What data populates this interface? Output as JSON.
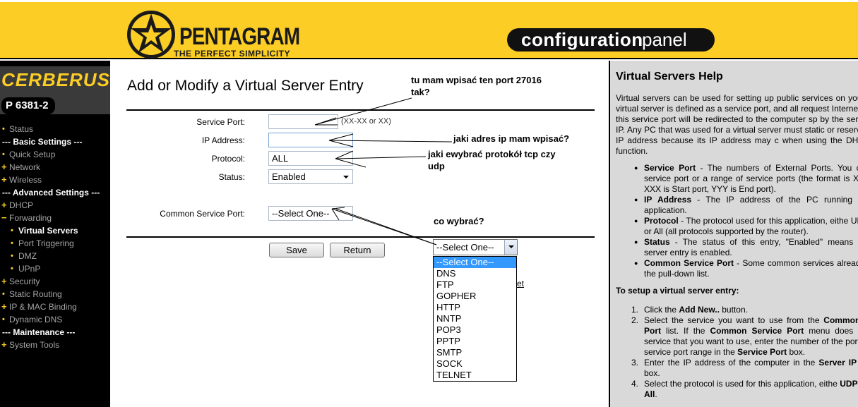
{
  "header": {
    "brand": "PENTAGRAM",
    "tagline": "THE PERFECT SIMPLICITY",
    "config_bold": "configuration",
    "config_light": "panel"
  },
  "sidebar": {
    "device_name": "CERBERUS",
    "model": "P 6381-2",
    "items": [
      {
        "label": "Status",
        "kind": "item"
      },
      {
        "label": "--- Basic Settings ---",
        "kind": "section"
      },
      {
        "label": "Quick Setup",
        "kind": "item"
      },
      {
        "label": "Network",
        "kind": "plus"
      },
      {
        "label": "Wireless",
        "kind": "plus"
      },
      {
        "label": "--- Advanced Settings ---",
        "kind": "section"
      },
      {
        "label": "DHCP",
        "kind": "plus"
      },
      {
        "label": "Forwarding",
        "kind": "minus"
      },
      {
        "label": "Virtual Servers",
        "kind": "sub-active"
      },
      {
        "label": "Port Triggering",
        "kind": "sub"
      },
      {
        "label": "DMZ",
        "kind": "sub"
      },
      {
        "label": "UPnP",
        "kind": "sub"
      },
      {
        "label": "Security",
        "kind": "plus"
      },
      {
        "label": "Static Routing",
        "kind": "item"
      },
      {
        "label": "IP & MAC Binding",
        "kind": "plus"
      },
      {
        "label": "Dynamic DNS",
        "kind": "item"
      },
      {
        "label": "--- Maintenance ---",
        "kind": "section"
      },
      {
        "label": "System Tools",
        "kind": "plus"
      }
    ]
  },
  "main": {
    "title": "Add or Modify a Virtual Server Entry",
    "service_port_label": "Service Port:",
    "service_port_value": "",
    "service_port_hint": "(XX-XX or XX)",
    "ip_address_label": "IP Address:",
    "ip_address_value": "",
    "protocol_label": "Protocol:",
    "protocol_value": "ALL",
    "status_label": "Status:",
    "status_value": "Enabled",
    "common_port_label": "Common Service Port:",
    "common_port_value": "--Select One--",
    "save_label": "Save",
    "return_label": "Return",
    "dropdown_value": "--Select One--",
    "dropdown_options": [
      "--Select One--",
      "DNS",
      "FTP",
      "GOPHER",
      "HTTP",
      "NNTP",
      "POP3",
      "PPTP",
      "SMTP",
      "SOCK",
      "TELNET"
    ],
    "partial_link": "et"
  },
  "annotations": {
    "a1_line1": "tu mam wpisać ten port 27016",
    "a1_line2": "tak?",
    "a2": "jaki adres ip mam wpisać?",
    "a3_line1": "jaki ewybrać protokół tcp czy",
    "a3_line2": "udp",
    "a4": "co wybrać?"
  },
  "help": {
    "title": "Virtual Servers Help",
    "intro": "Virtual servers can be used for setting up public services on you A virtual server is defined as a service port, and all request Internet to this service port will be redirected to the computer sp by the server IP. Any PC that was used for a virtual server must static or reserved IP address because its IP address may c when using the DHCP function.",
    "bullets": [
      {
        "term": "Service Port",
        "text": " - The numbers of External Ports. You can service port or a range of service ports (the format is XXX XXX is Start port, YYY is End port)."
      },
      {
        "term": "IP Address",
        "text": " - The IP address of the PC running the application."
      },
      {
        "term": "Protocol",
        "text": " - The protocol used for this application, eithe UDP, or All (all protocols supported by the router)."
      },
      {
        "term": "Status",
        "text": " - The status of this entry, \"Enabled\" means the server entry is enabled."
      },
      {
        "term": "Common Service Port",
        "text": " - Some common services alread in the pull-down list."
      }
    ],
    "setup_title": "To setup a virtual server entry:",
    "steps": [
      {
        "num": "1.",
        "html": "Click the <span class=\"hb\">Add New..</span> button."
      },
      {
        "num": "2.",
        "html": "Select the service you want to use from the <span class=\"hb\">Common S Port</span> list. If the <span class=\"hb\">Common Service Port</span> menu does not service that you want to use, enter the number of the port or service port range in the <span class=\"hb\">Service Port</span> box."
      },
      {
        "num": "3.",
        "html": "Enter the IP address of the computer in the <span class=\"hb\">Server IP ad</span> box."
      },
      {
        "num": "4.",
        "html": "Select the protocol is used for this application, eithe <span class=\"hb\">UDP</span>, or <span class=\"hb\">All</span>."
      }
    ]
  },
  "colors": {
    "header_yellow": "#fbcd25",
    "sidebar_black": "#000000",
    "help_gray": "#d9d9d9",
    "selection_blue": "#3399ff"
  }
}
